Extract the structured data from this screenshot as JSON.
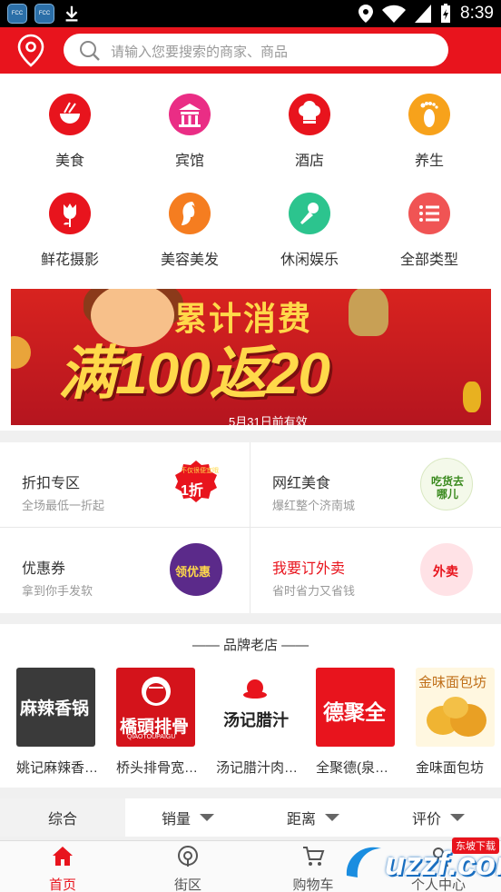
{
  "status_bar": {
    "time": "8:39",
    "app_icon_label": "FCC"
  },
  "search": {
    "placeholder": "请输入您要搜索的商家、商品"
  },
  "categories": [
    {
      "label": "美食",
      "icon": "noodle-bowl-icon",
      "color": "#e8141d"
    },
    {
      "label": "宾馆",
      "icon": "hotel-building-icon",
      "color": "#ea2d85"
    },
    {
      "label": "酒店",
      "icon": "chef-hat-icon",
      "color": "#e8141d"
    },
    {
      "label": "养生",
      "icon": "footprint-icon",
      "color": "#f7a21b"
    },
    {
      "label": "鲜花摄影",
      "icon": "rose-icon",
      "color": "#e8141d"
    },
    {
      "label": "美容美发",
      "icon": "woman-face-icon",
      "color": "#f57d20"
    },
    {
      "label": "休闲娱乐",
      "icon": "microphone-icon",
      "color": "#2cc48e"
    },
    {
      "label": "全部类型",
      "icon": "list-icon",
      "color": "#f05454"
    }
  ],
  "banner": {
    "headline": "累计消费",
    "offer": "满100返20",
    "note": "5月31日前有效"
  },
  "promos": [
    {
      "title": "折扣专区",
      "subtitle": "全场最低一折起",
      "badge": "1折",
      "badge_top": "不仅很便宜哦",
      "title_color": "#333333"
    },
    {
      "title": "网红美食",
      "subtitle": "爆红整个济南城",
      "badge": "吃货去哪儿",
      "title_color": "#333333"
    },
    {
      "title": "优惠券",
      "subtitle": "拿到你手发软",
      "badge": "领优惠",
      "title_color": "#333333"
    },
    {
      "title": "我要订外卖",
      "subtitle": "省时省力又省钱",
      "badge": "外卖",
      "title_color": "#e8141d"
    }
  ],
  "brands": {
    "title": "—— 品牌老店 ——",
    "stores": [
      {
        "name": "姚记麻辣香…",
        "logo_text": "麻辣香锅"
      },
      {
        "name": "桥头排骨宽…",
        "logo_text": "橋頭排骨",
        "logo_sub": "QIAOTOUPAIGU"
      },
      {
        "name": "汤记腊汁肉…",
        "logo_text": "汤记腊汁"
      },
      {
        "name": "全聚德(泉…",
        "logo_text": "德聚全"
      },
      {
        "name": "金味面包坊",
        "logo_text": "金味面包坊"
      }
    ]
  },
  "sort": {
    "items": [
      "综合",
      "销量",
      "距离",
      "评价"
    ]
  },
  "bottom_nav": {
    "items": [
      "首页",
      "街区",
      "购物车",
      "个人中心"
    ]
  },
  "watermark": {
    "text": "uzzf.com",
    "tag": "东坡下载"
  }
}
